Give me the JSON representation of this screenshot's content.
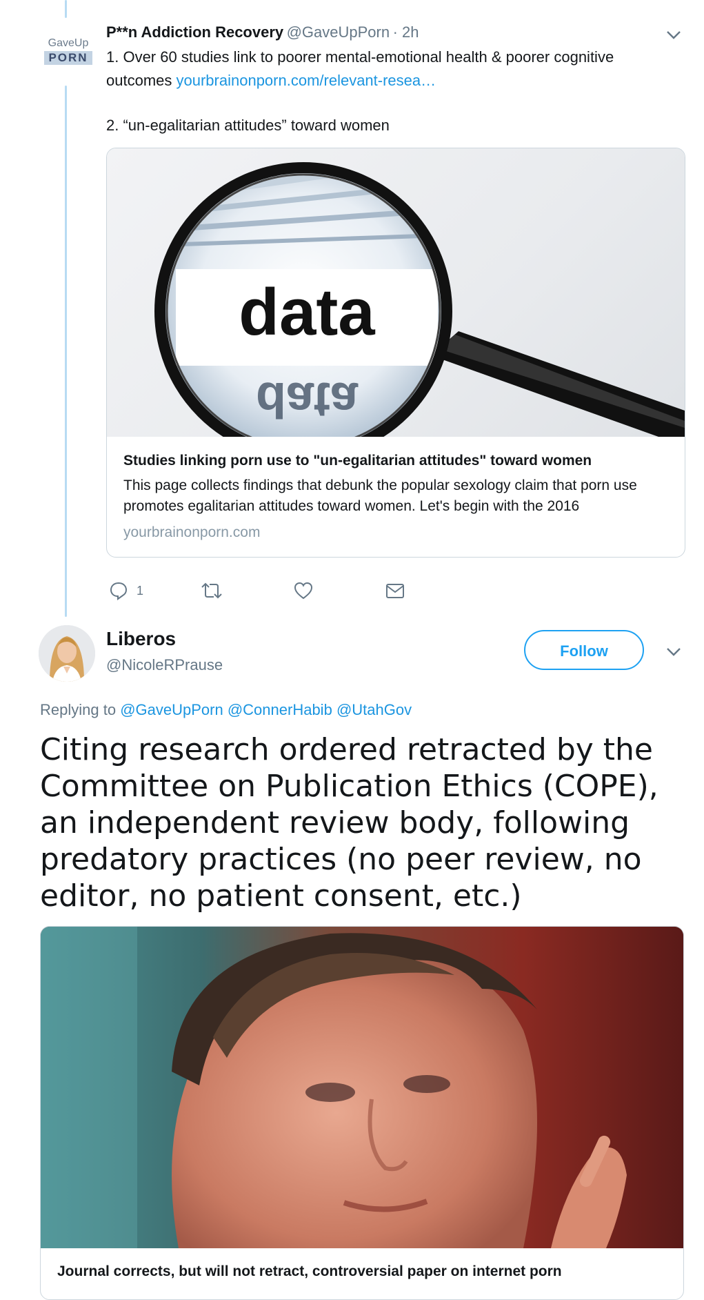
{
  "tweet1": {
    "avatar_text_top": "GaveUp",
    "avatar_text_bottom": "PORN",
    "author_name": "P**n Addiction Recovery",
    "author_handle": "@GaveUpPorn",
    "time": "· 2h",
    "text_part1": "1. Over 60 studies link to poorer mental-emotional health & poorer cognitive outcomes ",
    "text_link": "yourbrainonporn.com/relevant-resea…",
    "text_part2": "2.  “un-egalitarian attitudes” toward women",
    "card": {
      "image_word": "data",
      "image_word_reflection": "data",
      "title": "Studies linking porn use to \"un-egalitarian attitudes\" toward women",
      "description": "This page collects findings that debunk the popular sexology claim that porn use promotes egalitarian attitudes toward women. Let's begin with the 2016",
      "domain": "yourbrainonporn.com"
    },
    "actions": {
      "reply_count": "1",
      "reply_icon": "comment-icon",
      "retweet_icon": "retweet-icon",
      "like_icon": "heart-icon",
      "dm_icon": "envelope-icon"
    }
  },
  "tweet2": {
    "author_name": "Liberos",
    "author_handle": "@NicoleRPrause",
    "follow_label": "Follow",
    "replying_prefix": "Replying to ",
    "replying_to": [
      "@GaveUpPorn",
      "@ConnerHabib",
      "@UtahGov"
    ],
    "text": "Citing research ordered retracted by the Committee on Publication Ethics (COPE), an independent review body, following predatory practices (no peer review, no editor, no patient consent, etc.)",
    "card": {
      "title": "Journal corrects, but will not retract, controversial paper on internet porn"
    }
  },
  "colors": {
    "accent": "#1da1f2",
    "link": "#1b95e0",
    "muted": "#657786",
    "thread_line": "#b7dbf3"
  }
}
